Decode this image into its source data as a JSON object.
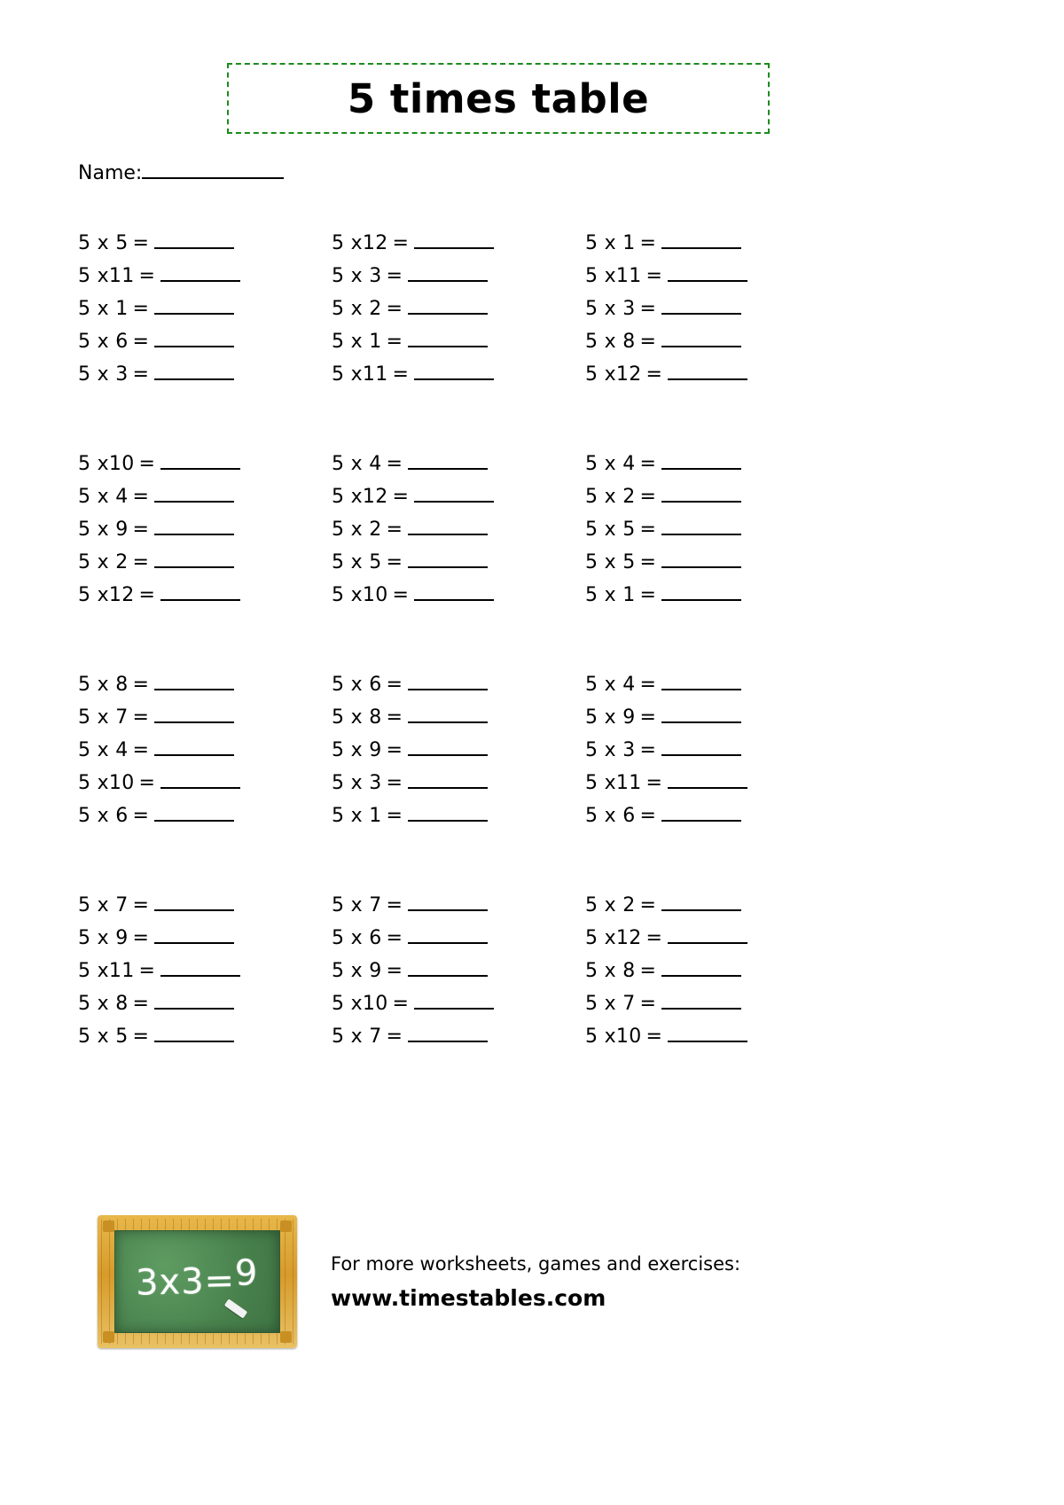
{
  "title": "5 times table",
  "name_field": {
    "label": "Name:",
    "value": ""
  },
  "blocks": [
    {
      "rows": [
        [
          {
            "left": "5 x",
            "right": " 5",
            "eq": "="
          },
          {
            "left": "5 x",
            "right": "12",
            "eq": "="
          },
          {
            "left": "5 x",
            "right": " 1",
            "eq": "="
          }
        ],
        [
          {
            "left": "5 x",
            "right": "11",
            "eq": "="
          },
          {
            "left": "5 x",
            "right": " 3",
            "eq": "="
          },
          {
            "left": "5 x",
            "right": "11",
            "eq": "="
          }
        ],
        [
          {
            "left": "5 x",
            "right": " 1",
            "eq": "="
          },
          {
            "left": "5 x",
            "right": " 2",
            "eq": "="
          },
          {
            "left": "5 x",
            "right": " 3",
            "eq": "="
          }
        ],
        [
          {
            "left": "5 x",
            "right": " 6",
            "eq": "="
          },
          {
            "left": "5 x",
            "right": " 1",
            "eq": "="
          },
          {
            "left": "5 x",
            "right": " 8",
            "eq": "="
          }
        ],
        [
          {
            "left": "5 x",
            "right": " 3",
            "eq": "="
          },
          {
            "left": "5 x",
            "right": "11",
            "eq": "="
          },
          {
            "left": "5 x",
            "right": "12",
            "eq": "="
          }
        ]
      ]
    },
    {
      "rows": [
        [
          {
            "left": "5 x",
            "right": "10",
            "eq": "="
          },
          {
            "left": "5 x",
            "right": " 4",
            "eq": "="
          },
          {
            "left": "5 x",
            "right": " 4",
            "eq": "="
          }
        ],
        [
          {
            "left": "5 x",
            "right": " 4",
            "eq": "="
          },
          {
            "left": "5 x",
            "right": "12",
            "eq": "="
          },
          {
            "left": "5 x",
            "right": " 2",
            "eq": "="
          }
        ],
        [
          {
            "left": "5 x",
            "right": " 9",
            "eq": "="
          },
          {
            "left": "5 x",
            "right": " 2",
            "eq": "="
          },
          {
            "left": "5 x",
            "right": " 5",
            "eq": "="
          }
        ],
        [
          {
            "left": "5 x",
            "right": " 2",
            "eq": "="
          },
          {
            "left": "5 x",
            "right": " 5",
            "eq": "="
          },
          {
            "left": "5 x",
            "right": " 5",
            "eq": "="
          }
        ],
        [
          {
            "left": "5 x",
            "right": "12",
            "eq": "="
          },
          {
            "left": "5 x",
            "right": "10",
            "eq": "="
          },
          {
            "left": "5 x",
            "right": " 1",
            "eq": "="
          }
        ]
      ]
    },
    {
      "rows": [
        [
          {
            "left": "5 x",
            "right": " 8",
            "eq": "="
          },
          {
            "left": "5 x",
            "right": " 6",
            "eq": "="
          },
          {
            "left": "5 x",
            "right": " 4",
            "eq": "="
          }
        ],
        [
          {
            "left": "5 x",
            "right": " 7",
            "eq": "="
          },
          {
            "left": "5 x",
            "right": " 8",
            "eq": "="
          },
          {
            "left": "5 x",
            "right": " 9",
            "eq": "="
          }
        ],
        [
          {
            "left": "5 x",
            "right": " 4",
            "eq": "="
          },
          {
            "left": "5 x",
            "right": " 9",
            "eq": "="
          },
          {
            "left": "5 x",
            "right": " 3",
            "eq": "="
          }
        ],
        [
          {
            "left": "5 x",
            "right": "10",
            "eq": "="
          },
          {
            "left": "5 x",
            "right": " 3",
            "eq": "="
          },
          {
            "left": "5 x",
            "right": "11",
            "eq": "="
          }
        ],
        [
          {
            "left": "5 x",
            "right": " 6",
            "eq": "="
          },
          {
            "left": "5 x",
            "right": " 1",
            "eq": "="
          },
          {
            "left": "5 x",
            "right": " 6",
            "eq": "="
          }
        ]
      ]
    },
    {
      "rows": [
        [
          {
            "left": "5 x",
            "right": " 7",
            "eq": "="
          },
          {
            "left": "5 x",
            "right": " 7",
            "eq": "="
          },
          {
            "left": "5 x",
            "right": " 2",
            "eq": "="
          }
        ],
        [
          {
            "left": "5 x",
            "right": " 9",
            "eq": "="
          },
          {
            "left": "5 x",
            "right": " 6",
            "eq": "="
          },
          {
            "left": "5 x",
            "right": "12",
            "eq": "="
          }
        ],
        [
          {
            "left": "5 x",
            "right": "11",
            "eq": "="
          },
          {
            "left": "5 x",
            "right": " 9",
            "eq": "="
          },
          {
            "left": "5 x",
            "right": " 8",
            "eq": "="
          }
        ],
        [
          {
            "left": "5 x",
            "right": " 8",
            "eq": "="
          },
          {
            "left": "5 x",
            "right": "10",
            "eq": "="
          },
          {
            "left": "5 x",
            "right": " 7",
            "eq": "="
          }
        ],
        [
          {
            "left": "5 x",
            "right": " 5",
            "eq": "="
          },
          {
            "left": "5 x",
            "right": " 7",
            "eq": "="
          },
          {
            "left": "5 x",
            "right": "10",
            "eq": "="
          }
        ]
      ]
    }
  ],
  "footer": {
    "chalkboard_equation_left": "3x3=",
    "chalkboard_equation_result": "9",
    "promo_line": "For more worksheets, games and exercises:",
    "website": "www.timestables.com"
  },
  "colors": {
    "title_border": "#1a8c1a",
    "board_green": "#4e8b53",
    "board_frame": "#e8b84b",
    "text": "#000000"
  }
}
